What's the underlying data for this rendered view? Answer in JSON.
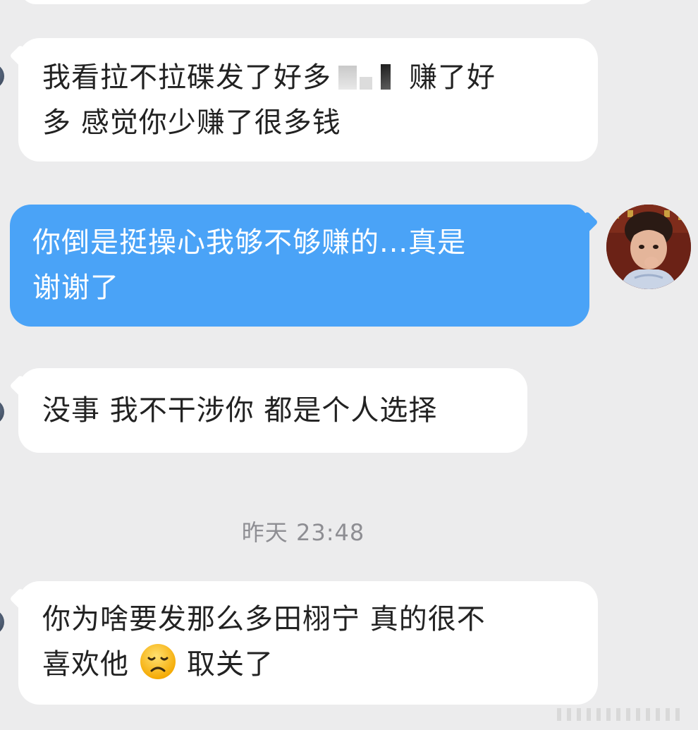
{
  "messages": [
    {
      "direction": "incoming",
      "line1_before": "我看拉不拉碟发了好多",
      "line1_after": "赚了好",
      "line2": "多 感觉你少赚了很多钱"
    },
    {
      "direction": "outgoing",
      "line1": "你倒是挺操心我够不够赚的...真是",
      "line2": "谢谢了"
    },
    {
      "direction": "incoming",
      "line1": "没事 我不干涉你 都是个人选择"
    },
    {
      "direction": "incoming",
      "line1": "你为啥要发那么多田栩宁 真的很不",
      "line2_before": "喜欢他",
      "line2_emoji": "disappointed-face-emoji",
      "line2_after": "取关了"
    }
  ],
  "timestamp": "昨天 23:48",
  "icons": {
    "right_avatar": "user-avatar-photo",
    "left_avatar": "contact-avatar"
  },
  "colors": {
    "background": "#ececed",
    "incoming_bubble": "#ffffff",
    "outgoing_bubble": "#4aa3f7",
    "timestamp_text": "#8e8e93"
  }
}
